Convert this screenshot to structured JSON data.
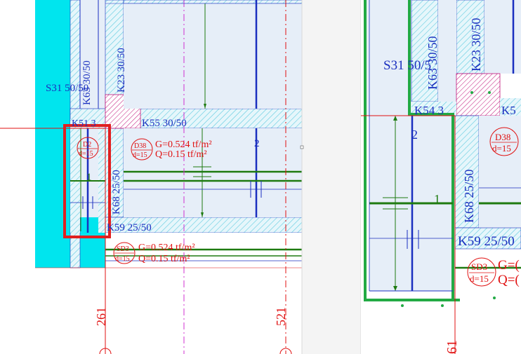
{
  "colors": {
    "background": "#ffffff",
    "panel_fill": "#e6eef8",
    "cyan_slab": "#00e5ee",
    "hatch": "#5ecbe0",
    "column_hatch": "#c0147a",
    "blue": "#1a2fbf",
    "red": "#e01010",
    "green": "#1e7a10",
    "bright_green": "#22aa44",
    "magenta_axis": "#d030d0",
    "selection_red": "#e02020"
  },
  "left_view": {
    "labels": {
      "slab_s31": "S31 50/50",
      "beam_k63": "K63 30/50",
      "beam_k23": "K23 30/50",
      "beam_k51": "K51 3",
      "beam_k55": "K55 30/50",
      "beam_k68": "K68 25/50",
      "beam_k59": "K59 25/50",
      "slab_num_2": "2",
      "slab_num_1": "1",
      "dim_261": "261",
      "dim_521": "521"
    },
    "loads": {
      "d38": {
        "code": "D38",
        "thickness": "d=15",
        "g": "G=0.524 tf/m²",
        "q": "Q=0.15 tf/m²"
      },
      "d2": {
        "code": "D2",
        "thickness": "d=15"
      },
      "sd3": {
        "code": "SD3",
        "thickness": "d=15",
        "g": "G=0.524 tf/m²",
        "q": "Q=0.15 tf/m²"
      }
    }
  },
  "right_view": {
    "labels": {
      "slab_s31": "S31 50/5",
      "beam_k63": "K63 30/50",
      "beam_k23": "K23 30/50",
      "beam_k54": "K54 3",
      "beam_k5": "K5",
      "beam_k68": "K68 25/50",
      "beam_k59": "K59 25/50",
      "slab_num_2": "2",
      "slab_num_1": "1",
      "dim_61": "61"
    },
    "loads": {
      "d38": {
        "code": "D38",
        "thickness": "d=15"
      },
      "sd3": {
        "code": "SD3",
        "thickness": "d=15",
        "g": "G=(",
        "q": "Q=("
      }
    }
  }
}
